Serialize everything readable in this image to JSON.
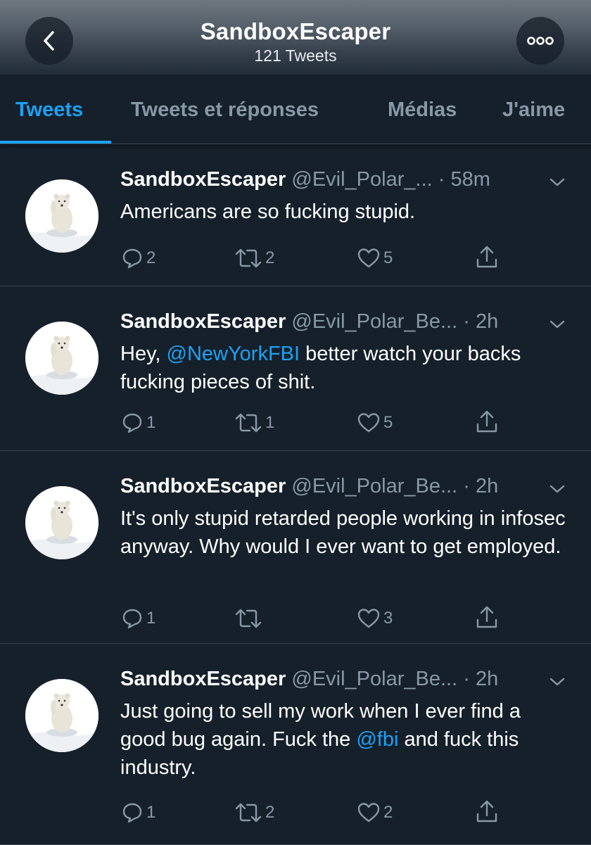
{
  "header": {
    "title": "SandboxEscaper",
    "tweet_count": "121 Tweets"
  },
  "tabs": [
    {
      "label": "Tweets",
      "active": true
    },
    {
      "label": "Tweets et réponses",
      "active": false
    },
    {
      "label": "Médias",
      "active": false
    },
    {
      "label": "J'aime",
      "active": false
    }
  ],
  "colors": {
    "background": "#15202b",
    "accent": "#1da1f2",
    "muted": "#8899a6",
    "divider": "#38444d"
  },
  "icons": {
    "back": "chevron-left-icon",
    "more": "more-horizontal-icon",
    "reply": "reply-icon",
    "retweet": "retweet-icon",
    "like": "heart-icon",
    "share": "share-icon",
    "caret": "chevron-down-icon",
    "avatar": "polar-bear-avatar"
  },
  "tweets": [
    {
      "name": "SandboxEscaper",
      "handle": "@Evil_Polar_...",
      "time": "· 58m",
      "text_parts": [
        "Americans are so fucking stupid."
      ],
      "replies": "2",
      "retweets": "2",
      "likes": "5"
    },
    {
      "name": "SandboxEscaper",
      "handle": "@Evil_Polar_Be...",
      "time": "· 2h",
      "text_parts": [
        "Hey, ",
        "@NewYorkFBI",
        " better watch your backs fucking pieces of shit."
      ],
      "replies": "1",
      "retweets": "1",
      "likes": "5"
    },
    {
      "name": "SandboxEscaper",
      "handle": "@Evil_Polar_Be...",
      "time": "· 2h",
      "text_parts": [
        "It's only stupid retarded people working in infosec anyway. Why would I ever want to get employed."
      ],
      "replies": "1",
      "retweets": "",
      "likes": "3"
    },
    {
      "name": "SandboxEscaper",
      "handle": "@Evil_Polar_Be...",
      "time": "· 2h",
      "text_parts": [
        "Just going to sell my work when I ever find a good bug again. Fuck the ",
        "@fbi",
        " and fuck this industry."
      ],
      "replies": "1",
      "retweets": "2",
      "likes": "2"
    }
  ]
}
